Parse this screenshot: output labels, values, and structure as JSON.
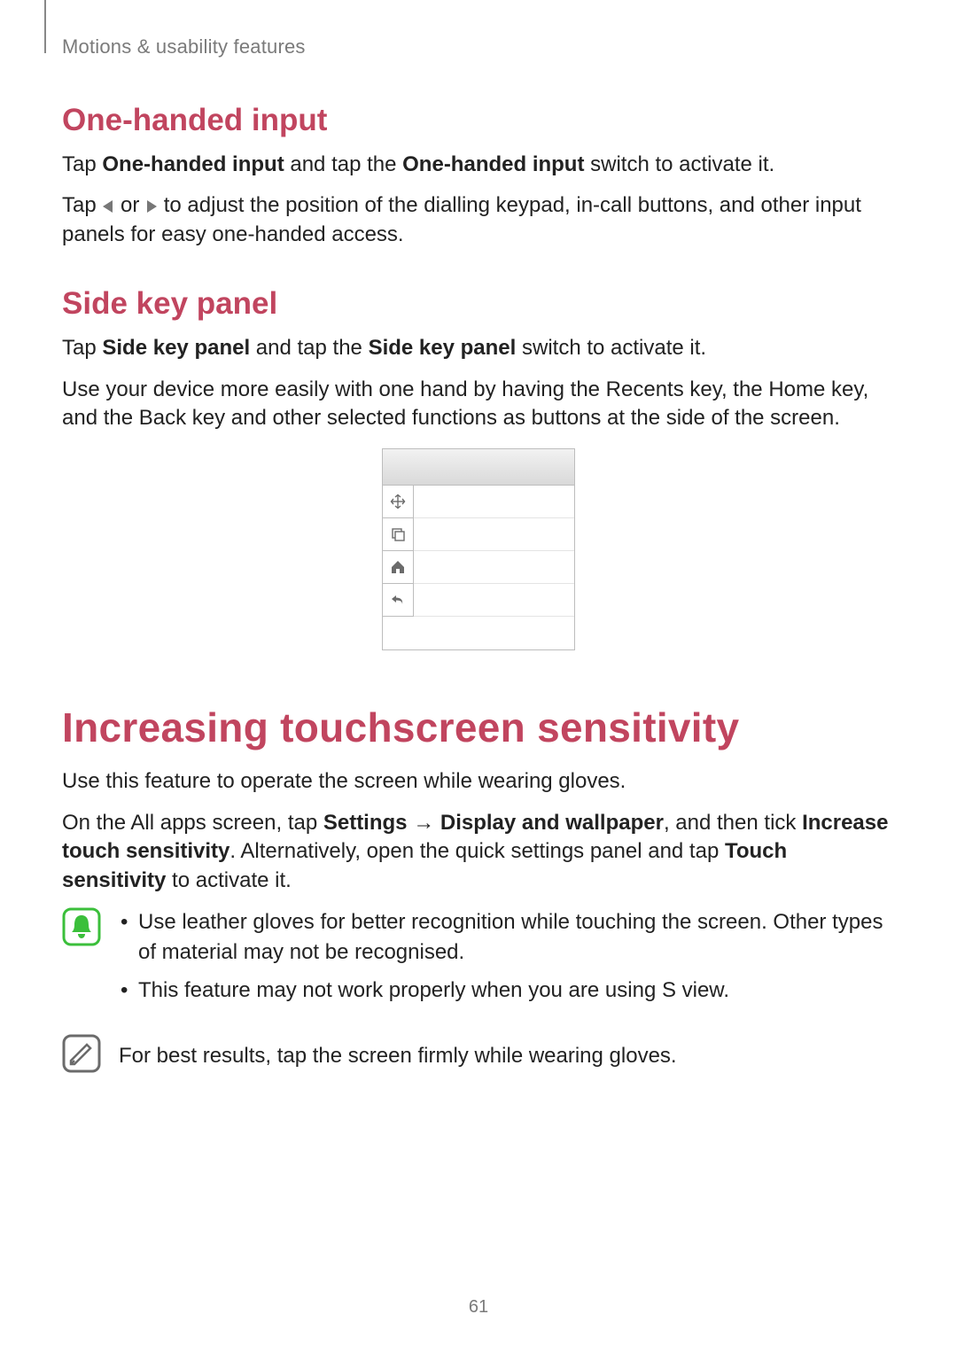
{
  "breadcrumb": "Motions & usability features",
  "sections": {
    "one_handed": {
      "heading": "One-handed input",
      "p1_a": "Tap ",
      "p1_b": "One-handed input",
      "p1_c": " and tap the ",
      "p1_d": "One-handed input",
      "p1_e": " switch to activate it.",
      "p2_a": "Tap ",
      "p2_b": " or ",
      "p2_c": " to adjust the position of the dialling keypad, in-call buttons, and other input panels for easy one-handed access."
    },
    "side_key": {
      "heading": "Side key panel",
      "p1_a": "Tap ",
      "p1_b": "Side key panel",
      "p1_c": " and tap the ",
      "p1_d": "Side key panel",
      "p1_e": " switch to activate it.",
      "p2": "Use your device more easily with one hand by having the Recents key, the Home key, and the Back key and other selected functions as buttons at the side of the screen."
    },
    "touch": {
      "heading": "Increasing touchscreen sensitivity",
      "p1": "Use this feature to operate the screen while wearing gloves.",
      "p2_a": "On the All apps screen, tap ",
      "p2_b": "Settings",
      "p2_c": " → ",
      "p2_d": "Display and wallpaper",
      "p2_e": ", and then tick ",
      "p2_f": "Increase touch sensitivity",
      "p2_g": ". Alternatively, open the quick settings panel and tap ",
      "p2_h": "Touch sensitivity",
      "p2_i": " to activate it.",
      "note1_li1": "Use leather gloves for better recognition while touching the screen. Other types of material may not be recognised.",
      "note1_li2": "This feature may not work properly when you are using S view.",
      "note2": "For best results, tap the screen firmly while wearing gloves."
    }
  },
  "page_number": "61"
}
